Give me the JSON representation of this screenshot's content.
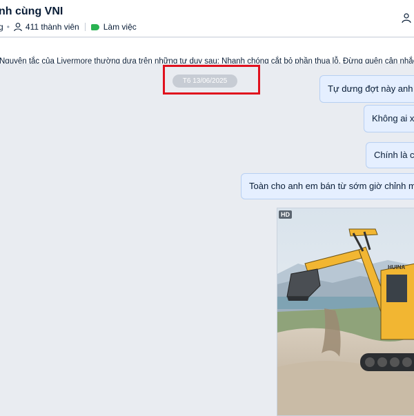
{
  "header": {
    "title": "nh cùng VNI",
    "meta_prefix": "g",
    "member_count": "411 thành viên",
    "tag": "Làm việc"
  },
  "pinned": {
    "text": "Nguyên tắc của Livermore thường dựa trên những tư duy sau: Nhanh chóng cắt bỏ phần thua lỗ. Đừng quên cân nhắc lại phán đ"
  },
  "chat": {
    "date_label": "T6 13/06/2025",
    "messages": [
      {
        "text": "Tự dưng đợt này anh em"
      },
      {
        "text": "Không ai xú"
      },
      {
        "text": "Chính là co"
      },
      {
        "text": "Toàn cho anh em bán từ sớm giờ chỉnh mua"
      }
    ],
    "image": {
      "badge": "HD",
      "printed_text": "HUINA"
    }
  },
  "colors": {
    "highlight": "#e0101d",
    "bubble_bg": "#e5efff",
    "tag": "#2ab352",
    "excavator": "#f2b632"
  },
  "icons": {
    "members": "user-icon",
    "tag": "tag-icon",
    "header_action": "add-member-icon"
  }
}
